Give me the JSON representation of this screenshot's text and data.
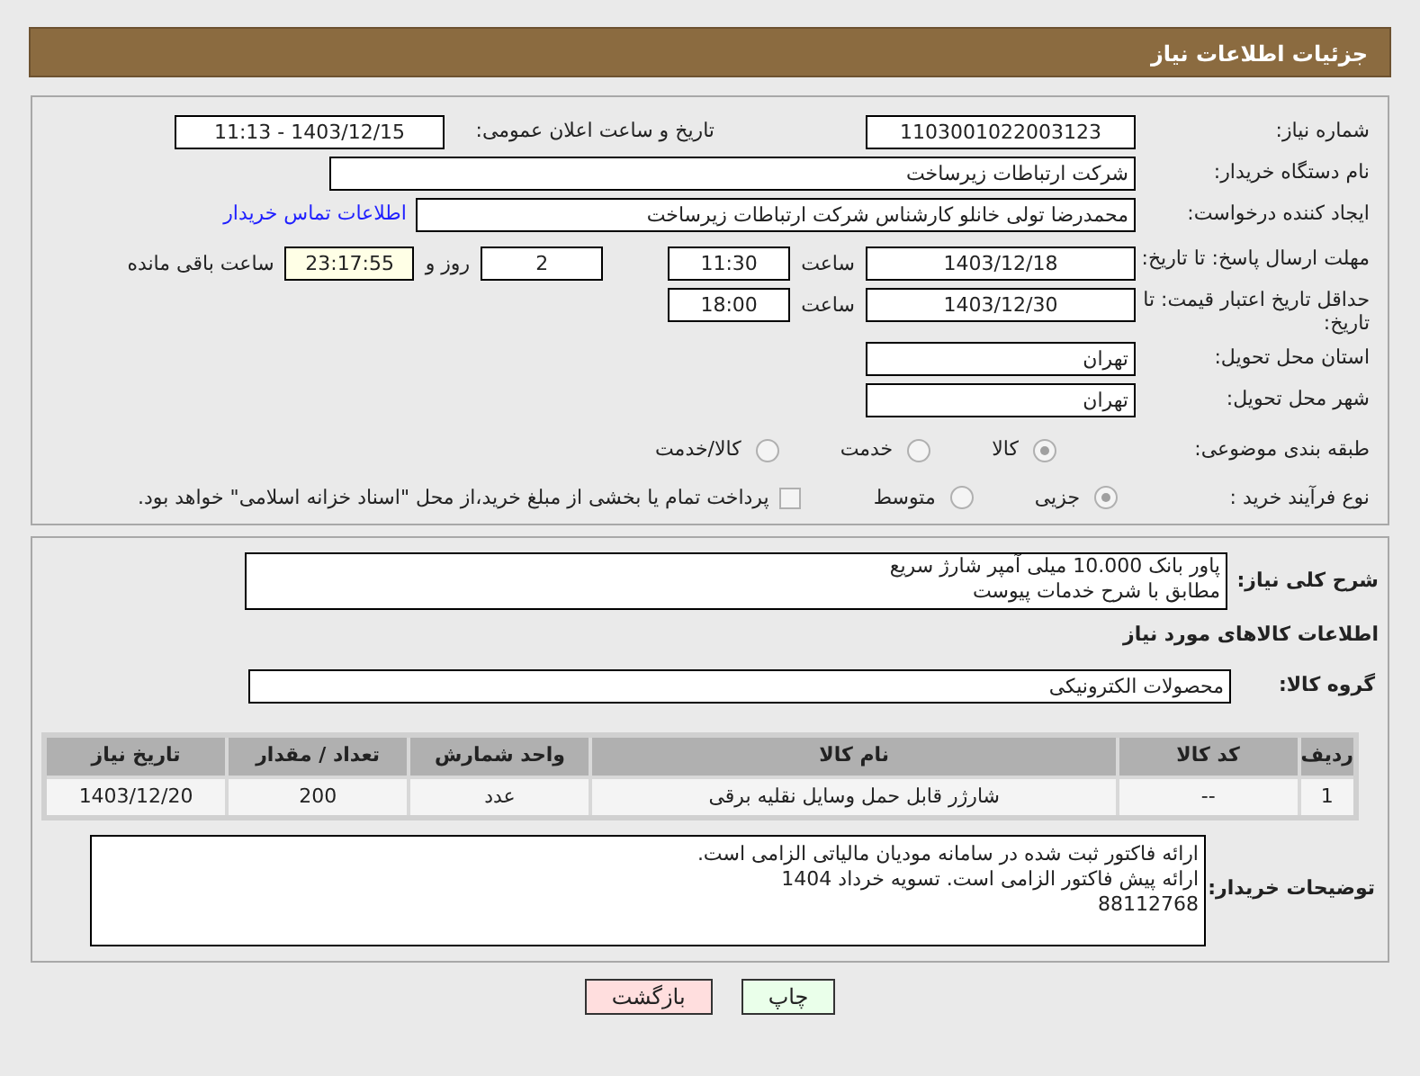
{
  "header": {
    "title": "جزئیات اطلاعات نیاز"
  },
  "need_number": {
    "label": "شماره نیاز:",
    "value": "1103001022003123"
  },
  "announce": {
    "label": "تاریخ و ساعت اعلان عمومی:",
    "value": "1403/12/15 - 11:13"
  },
  "buyer_org": {
    "label": "نام دستگاه خریدار:",
    "value": "شرکت ارتباطات زیرساخت"
  },
  "requester": {
    "label": "ایجاد کننده درخواست:",
    "value": "محمدرضا تولی خانلو کارشناس شرکت ارتباطات زیرساخت",
    "link": "اطلاعات تماس خریدار"
  },
  "deadline": {
    "label": "مهلت ارسال پاسخ: تا تاریخ:",
    "date": "1403/12/18",
    "time_label": "ساعت",
    "time": "11:30",
    "days": "2",
    "days_label": "روز و",
    "remaining": "23:17:55",
    "remaining_label": "ساعت باقی مانده"
  },
  "price_validity": {
    "label": "حداقل تاریخ اعتبار قیمت: تا تاریخ:",
    "date": "1403/12/30",
    "time_label": "ساعت",
    "time": "18:00"
  },
  "province": {
    "label": "استان محل تحویل:",
    "value": "تهران"
  },
  "city": {
    "label": "شهر محل تحویل:",
    "value": "تهران"
  },
  "category": {
    "label": "طبقه بندی موضوعی:",
    "options": [
      {
        "label": "کالا",
        "selected": true
      },
      {
        "label": "خدمت",
        "selected": false
      },
      {
        "label": "کالا/خدمت",
        "selected": false
      }
    ]
  },
  "process": {
    "label": "نوع فرآیند خرید :",
    "options": [
      {
        "label": "جزیی",
        "selected": true
      },
      {
        "label": "متوسط",
        "selected": false
      }
    ],
    "note": {
      "checked": false,
      "text": "پرداخت تمام یا بخشی از مبلغ خرید،از محل \"اسناد خزانه اسلامی\" خواهد بود."
    }
  },
  "description": {
    "label": "شرح کلی نیاز:",
    "lines": [
      "پاور بانک 10.000 میلی آمپر شارژ سریع",
      "مطابق با شرح خدمات پیوست"
    ]
  },
  "goods_title": "اطلاعات کالاهای مورد نیاز",
  "goods_group": {
    "label": "گروه کالا:",
    "value": "محصولات الکترونیکی"
  },
  "table": {
    "columns": [
      "ردیف",
      "کد کالا",
      "نام کالا",
      "واحد شمارش",
      "تعداد / مقدار",
      "تاریخ نیاز"
    ],
    "rows": [
      [
        "1",
        "--",
        "شارژر قابل حمل وسایل نقلیه برقی",
        "عدد",
        "200",
        "1403/12/20"
      ]
    ]
  },
  "buyer_notes": {
    "label": "توضیحات خریدار:",
    "lines": [
      "ارائه فاکتور ثبت شده در سامانه مودیان مالیاتی الزامی است.",
      "ارائه پیش فاکتور الزامی است. تسویه خرداد 1404",
      "88112768"
    ]
  },
  "buttons": [
    {
      "label": "چاپ",
      "kind": "print"
    },
    {
      "label": "بازگشت",
      "kind": "back"
    }
  ]
}
